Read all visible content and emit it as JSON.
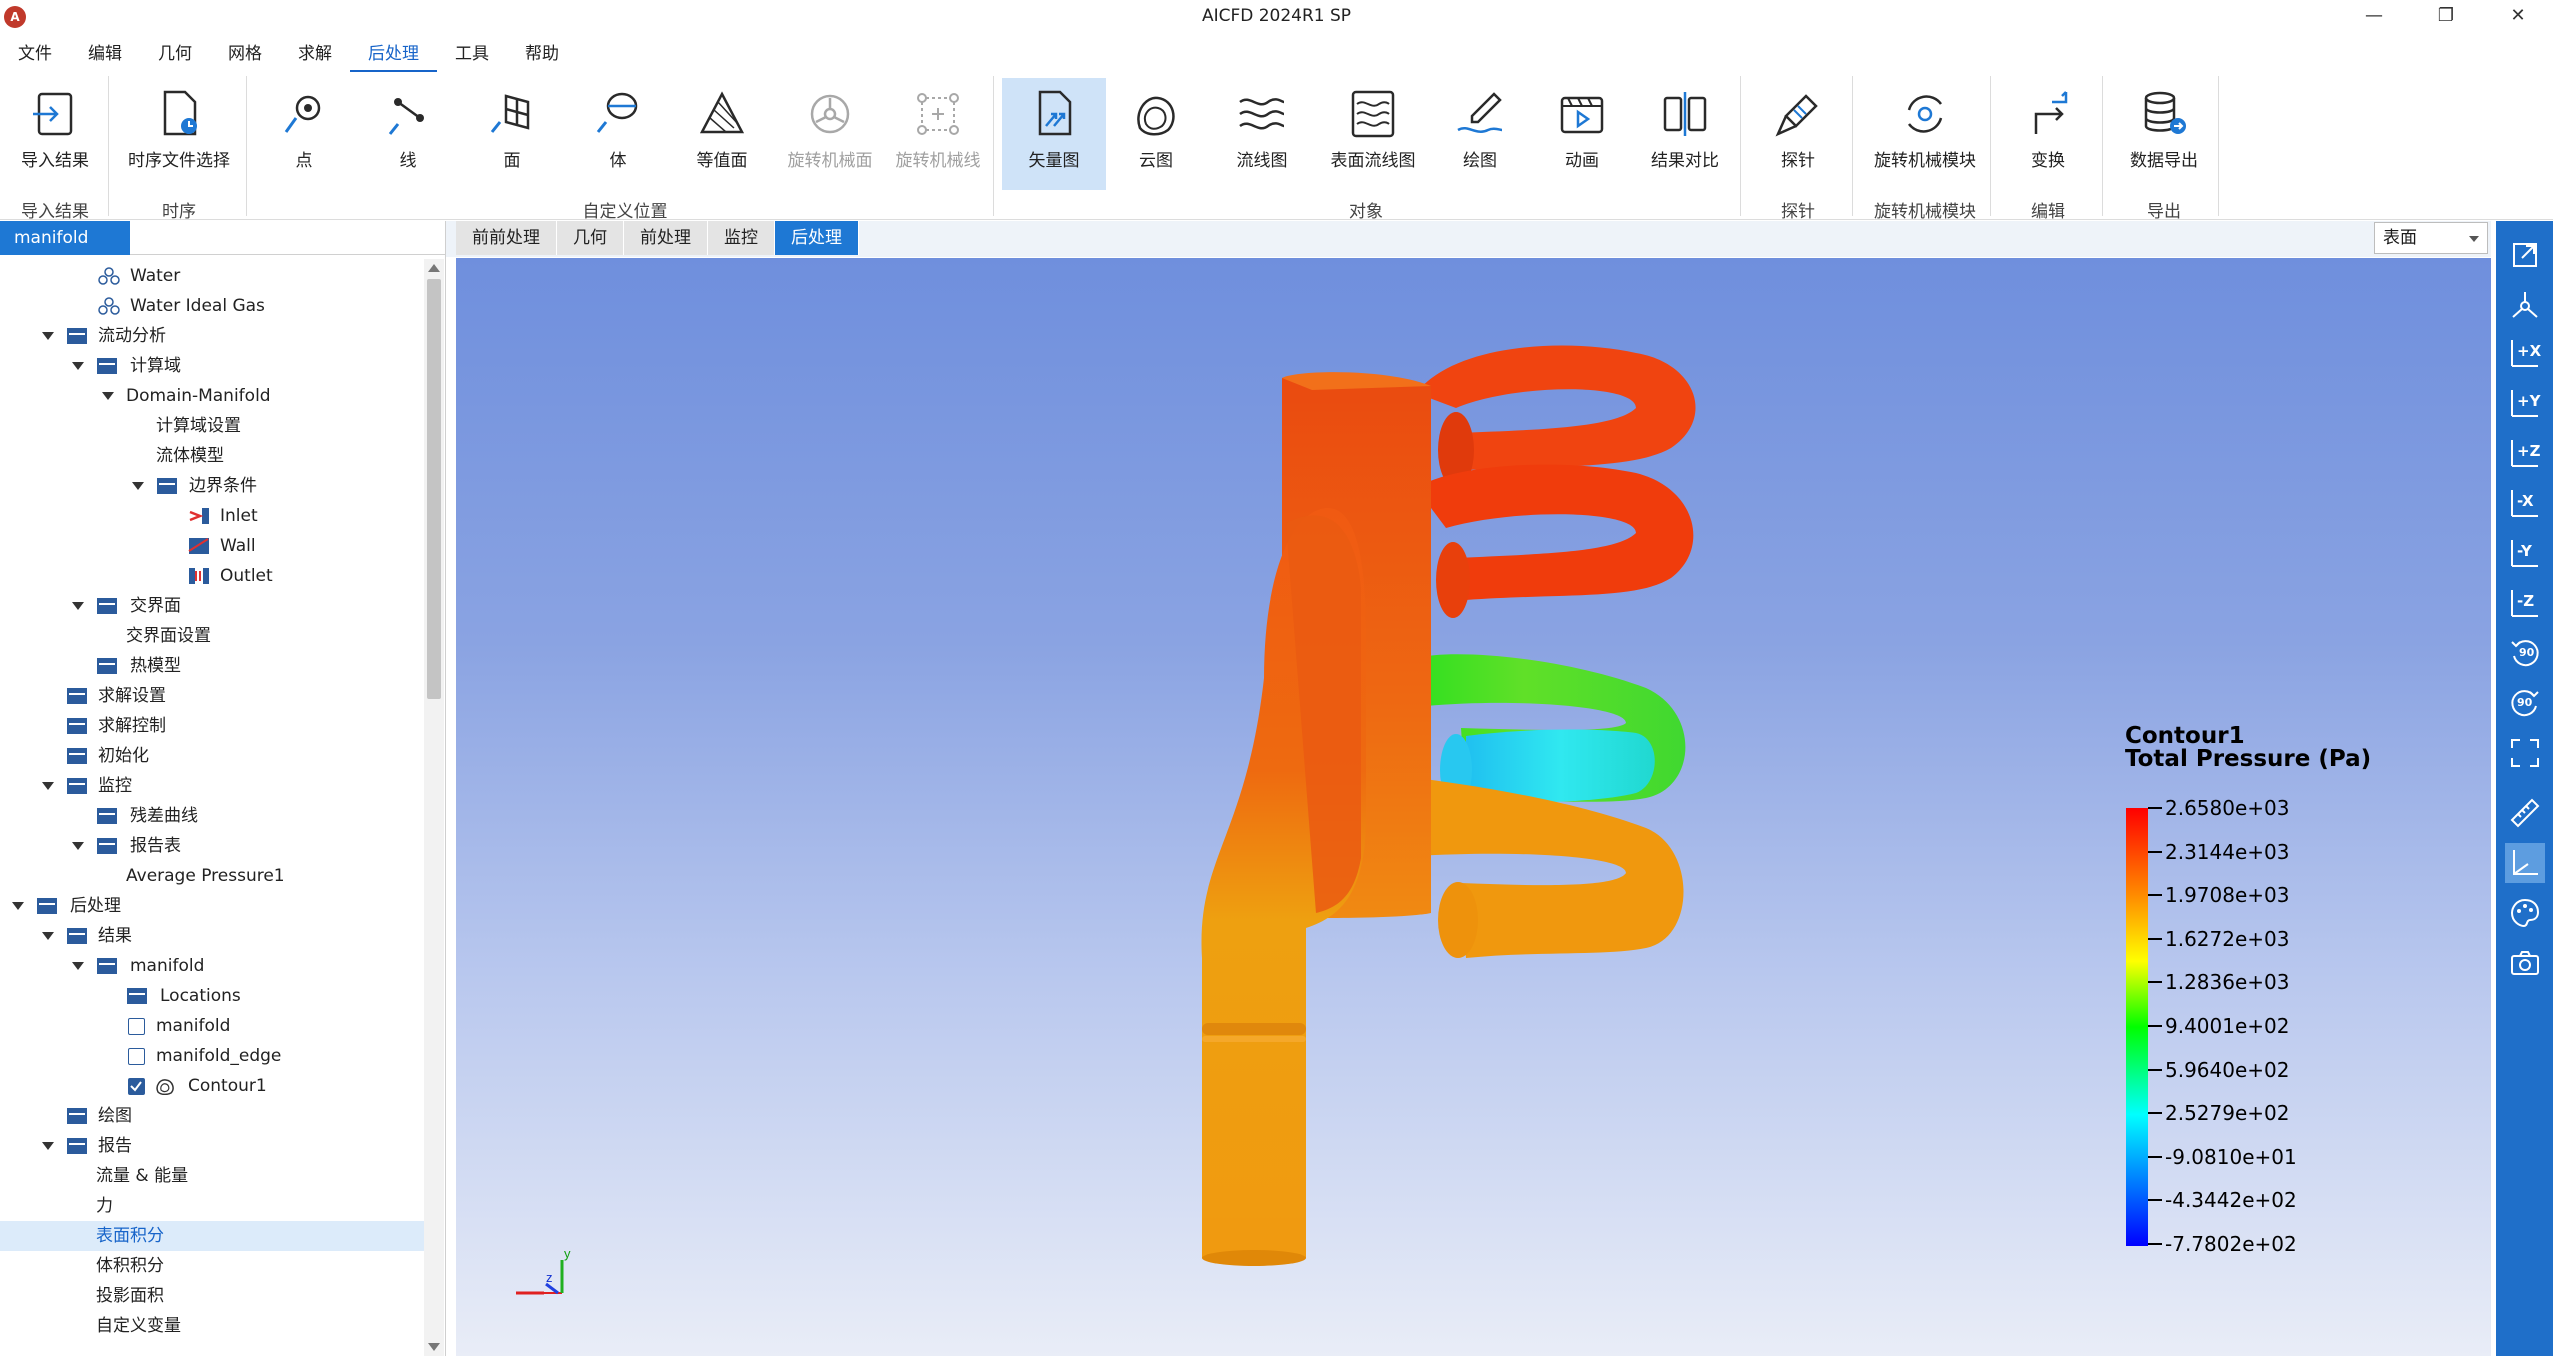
{
  "window": {
    "title": "AICFD 2024R1 SP",
    "logo_text": "A",
    "minimize": "—",
    "restore": "❐",
    "close": "✕"
  },
  "menu": [
    "文件",
    "编辑",
    "几何",
    "网格",
    "求解",
    "后处理",
    "工具",
    "帮助"
  ],
  "ribbon": {
    "buttons": {
      "import_result": "导入结果",
      "time_file": "时序文件选择",
      "point": "点",
      "line": "线",
      "face": "面",
      "volume": "体",
      "isosurface": "等值面",
      "rot_face": "旋转机械面",
      "rot_line": "旋转机械线",
      "vector": "矢量图",
      "contour": "云图",
      "streamline": "流线图",
      "surface_stream": "表面流线图",
      "plot": "绘图",
      "animation": "动画",
      "compare": "结果对比",
      "probe": "探针",
      "rot_module": "旋转机械模块",
      "transform": "变换",
      "export": "数据导出"
    },
    "groups": {
      "import": "导入结果",
      "time": "时序",
      "custom_location": "自定义位置",
      "object": "对象",
      "probe": "探针",
      "rot": "旋转机械模块",
      "edit": "编辑",
      "export": "导出"
    }
  },
  "left_panel": {
    "tab": "manifold",
    "tree": {
      "water": "Water",
      "water_ideal_gas": "Water Ideal Gas",
      "flow_analysis": "流动分析",
      "domain": "计算域",
      "domain_manifold": "Domain-Manifold",
      "domain_settings": "计算域设置",
      "fluid_model": "流体模型",
      "boundary": "边界条件",
      "inlet": "Inlet",
      "wall": "Wall",
      "outlet": "Outlet",
      "interface": "交界面",
      "interface_settings": "交界面设置",
      "heat_model": "热模型",
      "solve_settings": "求解设置",
      "solve_control": "求解控制",
      "init": "初始化",
      "monitor": "监控",
      "residual": "残差曲线",
      "report_table": "报告表",
      "avg_pressure": "Average Pressure1",
      "postprocess": "后处理",
      "results": "结果",
      "manifold": "manifold",
      "locations": "Locations",
      "manifold_obj": "manifold",
      "manifold_edge": "manifold_edge",
      "contour1": "Contour1",
      "plots": "绘图",
      "report": "报告",
      "flow_energy": "流量 & 能量",
      "force": "力",
      "surface_integral": "表面积分",
      "volume_integral": "体积积分",
      "projected_area": "投影面积",
      "custom_var": "自定义变量"
    }
  },
  "viewport": {
    "tabs": [
      "前前处理",
      "几何",
      "前处理",
      "监控",
      "后处理"
    ],
    "active_tab": "后处理",
    "display_mode": "表面",
    "legend": {
      "title": "Contour1",
      "variable": "Total Pressure (Pa)",
      "values": [
        "2.6580e+03",
        "2.3144e+03",
        "1.9708e+03",
        "1.6272e+03",
        "1.2836e+03",
        "9.4001e+02",
        "5.9640e+02",
        "2.5279e+02",
        "-9.0810e+01",
        "-4.3442e+02",
        "-7.7802e+02"
      ]
    },
    "axes": {
      "y": "y",
      "z": "z"
    }
  },
  "right_toolbar": {
    "x_pos": "+X",
    "y_pos": "+Y",
    "z_pos": "+Z",
    "x_neg": "-X",
    "y_neg": "-Y",
    "z_neg": "-Z",
    "rot_ccw": "90",
    "rot_cw": "90"
  },
  "colors": {
    "accent": "#1e78d4",
    "high_pressure": "#ff2a00",
    "low_pressure": "#00e5ff"
  }
}
